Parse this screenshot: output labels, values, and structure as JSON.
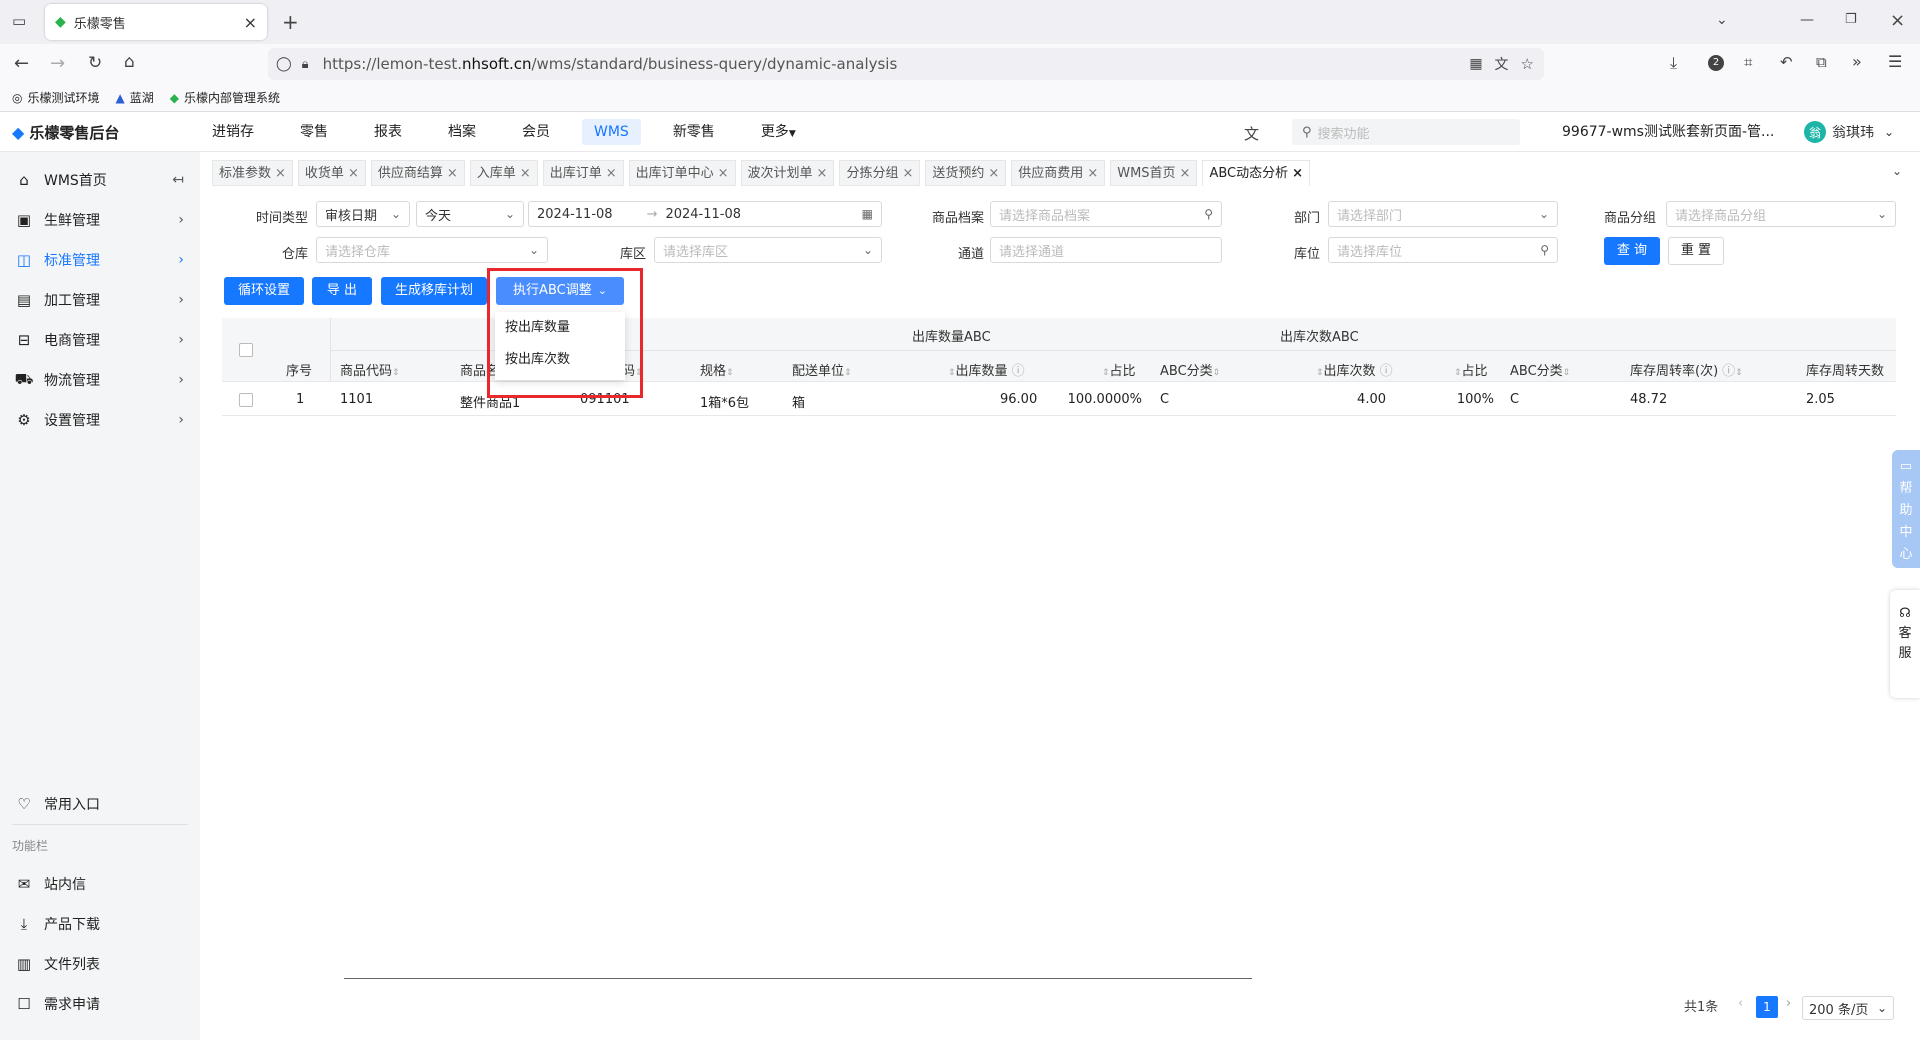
{
  "browser": {
    "tab_title": "乐檬零售",
    "url_prefix": "https://lemon-test.",
    "url_domain": "nhsoft.cn",
    "url_path": "/wms/standard/business-query/dynamic-analysis",
    "downloads_badge": "2"
  },
  "bookmarks": [
    "乐檬测试环境",
    "蓝湖",
    "乐檬内部管理系统"
  ],
  "app": {
    "logo": "乐檬零售后台",
    "nav": [
      "进销存",
      "零售",
      "报表",
      "档案",
      "会员",
      "WMS",
      "新零售",
      "更多"
    ],
    "nav_active": "WMS",
    "search_placeholder": "搜索功能",
    "account": "99677-wms测试账套新页面-管...",
    "avatar_text": "翁",
    "user": "翁琪玮"
  },
  "sidebar": {
    "items": [
      "WMS首页",
      "生鲜管理",
      "标准管理",
      "加工管理",
      "电商管理",
      "物流管理",
      "设置管理"
    ],
    "active": "标准管理",
    "common": "常用入口",
    "section": "功能栏",
    "tools": [
      "站内信",
      "产品下载",
      "文件列表",
      "需求申请"
    ]
  },
  "page_tabs": [
    "标准参数",
    "收货单",
    "供应商结算",
    "入库单",
    "出库订单",
    "出库订单中心",
    "波次计划单",
    "分拣分组",
    "送货预约",
    "供应商费用",
    "WMS首页",
    "ABC动态分析"
  ],
  "filters": {
    "time_type_label": "时间类型",
    "time_type": "审核日期",
    "range": "今天",
    "date_start": "2024-11-08",
    "date_end": "2024-11-08",
    "product_label": "商品档案",
    "product_ph": "请选择商品档案",
    "dept_label": "部门",
    "dept_ph": "请选择部门",
    "group_label": "商品分组",
    "group_ph": "请选择商品分组",
    "wh_label": "仓库",
    "wh_ph": "请选择仓库",
    "zone_label": "库区",
    "zone_ph": "请选择库区",
    "aisle_label": "通道",
    "aisle_ph": "请选择通道",
    "loc_label": "库位",
    "loc_ph": "请选择库位",
    "query": "查 询",
    "reset": "重 置"
  },
  "actions": {
    "cycle": "循环设置",
    "export": "导 出",
    "move_plan": "生成移库计划",
    "exec": "执行ABC调整",
    "menu": [
      "按出库数量",
      "按出库次数"
    ]
  },
  "table": {
    "group1": "出库数量ABC",
    "group2": "出库次数ABC",
    "headers": [
      "序号",
      "商品代码",
      "商品名",
      "码",
      "规格",
      "配送单位",
      "出库数量",
      "占比",
      "ABC分类",
      "出库次数",
      "占比",
      "ABC分类",
      "库存周转率(次)",
      "库存周转天数"
    ],
    "row": [
      "1",
      "1101",
      "整件商品1",
      "091101",
      "1箱*6包",
      "箱",
      "96.00",
      "100.0000%",
      "C",
      "4.00",
      "100%",
      "C",
      "48.72",
      "2.05"
    ]
  },
  "pager": {
    "total": "共1条",
    "page": "1",
    "size": "200 条/页"
  },
  "float": {
    "help": [
      "帮",
      "助",
      "中",
      "心"
    ],
    "service": [
      "客",
      "服"
    ]
  },
  "colors": {
    "primary": "#1677ff",
    "highlight_border": "#e8282c"
  }
}
